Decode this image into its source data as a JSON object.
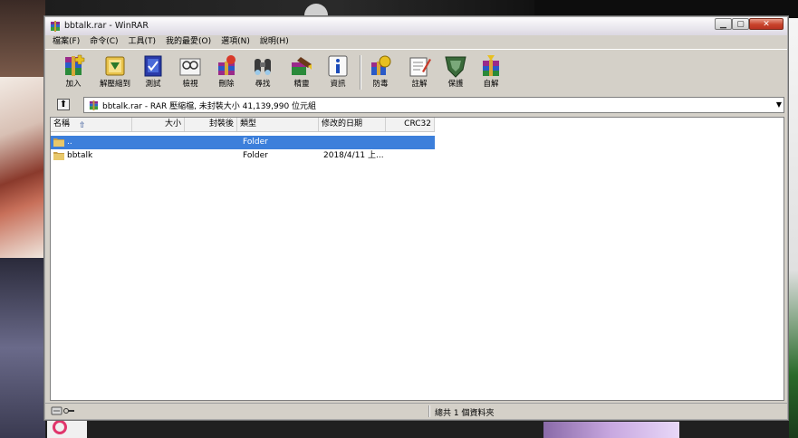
{
  "window": {
    "title": "bbtalk.rar - WinRAR",
    "buttons": {
      "minimize": "▁",
      "maximize": "▢",
      "close": "✕"
    }
  },
  "menu": [
    "檔案(F)",
    "命令(C)",
    "工具(T)",
    "我的最愛(O)",
    "選項(N)",
    "說明(H)"
  ],
  "toolbar": [
    {
      "label": "加入",
      "icon": "add-archive-icon"
    },
    {
      "label": "解壓縮到",
      "icon": "extract-to-icon"
    },
    {
      "label": "測試",
      "icon": "test-icon"
    },
    {
      "label": "檢視",
      "icon": "view-icon"
    },
    {
      "label": "刪除",
      "icon": "delete-icon"
    },
    {
      "label": "尋找",
      "icon": "find-icon"
    },
    {
      "label": "精靈",
      "icon": "wizard-icon"
    },
    {
      "label": "資訊",
      "icon": "info-icon"
    },
    {
      "label": "防毒",
      "icon": "virus-scan-icon"
    },
    {
      "label": "註解",
      "icon": "comment-icon"
    },
    {
      "label": "保護",
      "icon": "protect-icon"
    },
    {
      "label": "自解",
      "icon": "sfx-icon"
    }
  ],
  "address": {
    "text": "bbtalk.rar - RAR 壓縮檔, 未封裝大小 41,139,990 位元組"
  },
  "columns": {
    "name": "名稱",
    "size": "大小",
    "packed": "封裝後",
    "type": "類型",
    "modified": "修改的日期",
    "crc": "CRC32"
  },
  "rows": [
    {
      "name": "..",
      "size": "",
      "packed": "",
      "type": "Folder",
      "modified": "",
      "crc": "",
      "selected": true
    },
    {
      "name": "bbtalk",
      "size": "",
      "packed": "",
      "type": "Folder",
      "modified": "2018/4/11 上...",
      "crc": "",
      "selected": false
    }
  ],
  "status": {
    "text": "總共 1 個資料夾"
  },
  "colors": {
    "selection": "#3c7fdb",
    "window_face": "#d4d0c8",
    "close_button": "#c8432c"
  }
}
